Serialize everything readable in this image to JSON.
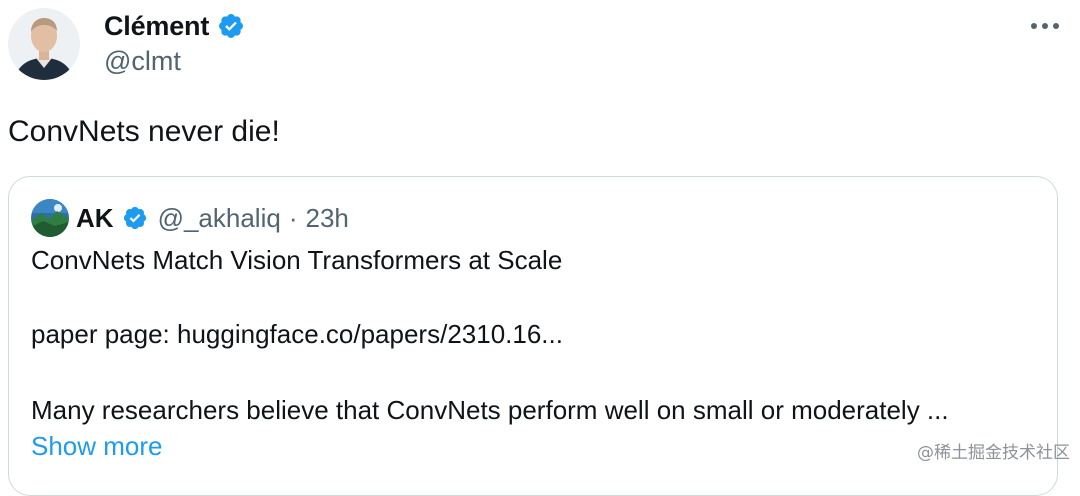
{
  "author": {
    "name": "Clément",
    "handle": "@clmt",
    "verified_icon": "verified-badge-icon",
    "accent": "#1d9bf0"
  },
  "menu": {
    "icon": "more-horizontal-icon"
  },
  "tweet": {
    "text": "ConvNets never die!"
  },
  "quote": {
    "name": "AK",
    "handle": "@_akhaliq",
    "separator": "·",
    "time": "23h",
    "lines": [
      "ConvNets Match Vision Transformers at Scale",
      "paper page: huggingface.co/papers/2310.16...",
      "Many researchers believe that ConvNets perform well on small or moderately ..."
    ],
    "show_more": "Show more"
  },
  "watermark": "@稀土掘金技术社区"
}
